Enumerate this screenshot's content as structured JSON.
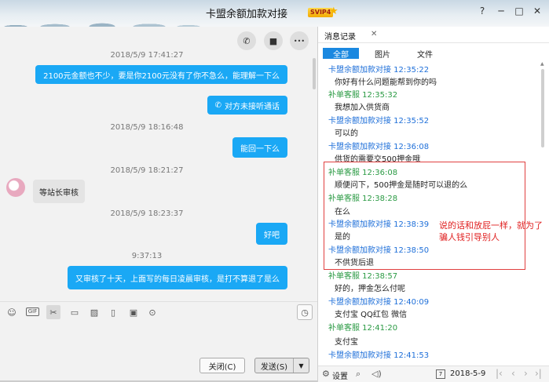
{
  "window": {
    "title": "卡盟余额加款对接",
    "badge": "SVIP4",
    "controls": {
      "help": "?",
      "minimize": "─",
      "maximize": "□",
      "close": "✕"
    }
  },
  "chat": {
    "actions": {
      "call": "✆",
      "video": "■",
      "more": "•••"
    },
    "timestamps": [
      "2018/5/9 17:41:27",
      "2018/5/9 18:16:48",
      "2018/5/9 18:21:27",
      "2018/5/9 18:23:37",
      "9:37:13"
    ],
    "messages": [
      {
        "text": "2100元金额也不少，要是你2100元没有了你不急么，能理解一下么"
      },
      {
        "text": "对方未接听通话"
      },
      {
        "text": "能回一下么"
      },
      {
        "text": "等站长审核"
      },
      {
        "text": "好吧"
      },
      {
        "text": "又审核了十天，上面写的每日凌晨审核，是打不算退了是么"
      }
    ]
  },
  "toolbar": {
    "icons": [
      "emoji-icon",
      "gif-icon",
      "scissors-icon",
      "folder-icon",
      "image-icon",
      "shake-icon",
      "red-packet-icon",
      "more-icon"
    ],
    "gif_text": "GIF"
  },
  "input": {
    "close_label": "关闭(C)",
    "send_label": "发送(S)"
  },
  "history": {
    "title": "消息记录",
    "close": "✕",
    "tabs": [
      "全部",
      "图片",
      "文件"
    ],
    "entries": [
      {
        "sender": "卡盟余额加款对接 12:35:22",
        "role": "blue",
        "text": "你好有什么问题能帮到你的吗"
      },
      {
        "sender": "补单客服 12:35:32",
        "role": "green",
        "text": "我想加入供货商"
      },
      {
        "sender": "卡盟余额加款对接 12:35:52",
        "role": "blue",
        "text": "可以的"
      },
      {
        "sender": "卡盟余额加款对接 12:36:08",
        "role": "blue",
        "text": "供货的需要交500押金哦"
      },
      {
        "sender": "补单客服 12:36:08",
        "role": "green",
        "text": "顺便问下，500押金是随时可以退的么"
      },
      {
        "sender": "补单客服 12:38:28",
        "role": "green",
        "text": "在么"
      },
      {
        "sender": "卡盟余额加款对接 12:38:39",
        "role": "blue",
        "text": "是的"
      },
      {
        "sender": "卡盟余额加款对接 12:38:50",
        "role": "blue",
        "text": "不供货后退"
      },
      {
        "sender": "补单客服 12:38:57",
        "role": "green",
        "text": "好的，押金怎么付呢"
      },
      {
        "sender": "卡盟余额加款对接 12:40:09",
        "role": "blue",
        "text": "支付宝 QQ红包 微信"
      },
      {
        "sender": "补单客服 12:41:20",
        "role": "green",
        "text": "支付宝"
      },
      {
        "sender": "卡盟余额加款对接 12:41:53",
        "role": "blue",
        "text": ""
      }
    ],
    "annotation": "说的话和放屁一样，就为了骗人钱引导别人",
    "footer": {
      "settings": "设置",
      "date": "2018-5-9",
      "date_icon_text": "7"
    }
  }
}
